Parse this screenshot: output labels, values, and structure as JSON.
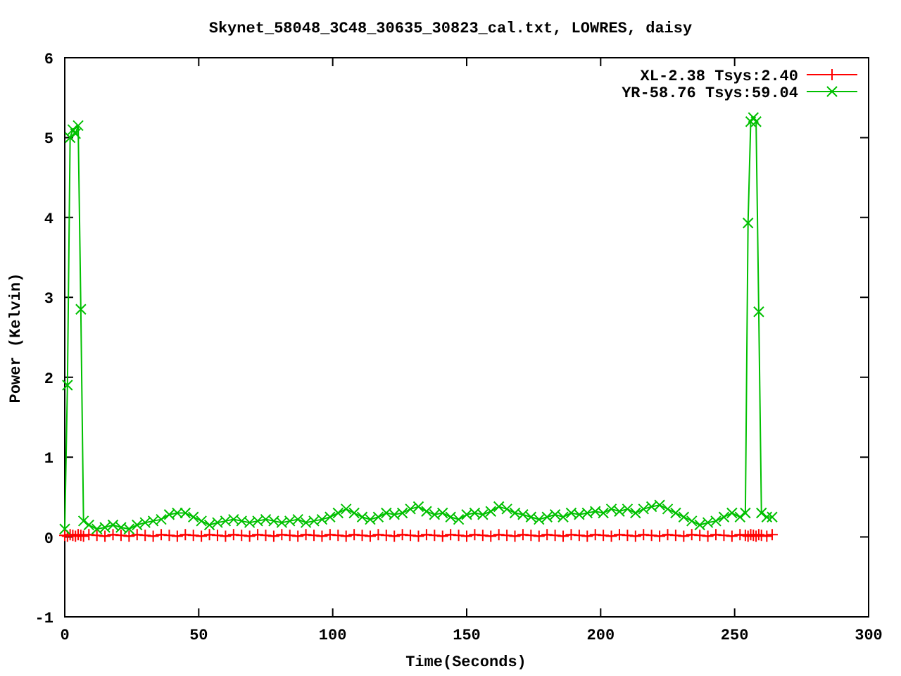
{
  "chart_data": {
    "type": "line",
    "title": "Skynet_58048_3C48_30635_30823_cal.txt, LOWRES, daisy",
    "xlabel": "Time(Seconds)",
    "ylabel": "Power (Kelvin)",
    "xlim": [
      0,
      300
    ],
    "ylim": [
      -1,
      6
    ],
    "xticks": [
      0,
      50,
      100,
      150,
      200,
      250,
      300
    ],
    "yticks": [
      -1,
      0,
      1,
      2,
      3,
      4,
      5,
      6
    ],
    "legend": true,
    "x": [
      0,
      1,
      2,
      3,
      4,
      5,
      6,
      7,
      9,
      12,
      15,
      18,
      21,
      24,
      27,
      30,
      33,
      36,
      39,
      42,
      45,
      48,
      51,
      54,
      57,
      60,
      63,
      66,
      69,
      72,
      75,
      78,
      81,
      84,
      87,
      90,
      93,
      96,
      99,
      102,
      105,
      108,
      111,
      114,
      117,
      120,
      123,
      126,
      129,
      132,
      135,
      138,
      141,
      144,
      147,
      150,
      153,
      156,
      159,
      162,
      165,
      168,
      171,
      174,
      177,
      180,
      183,
      186,
      189,
      192,
      195,
      198,
      201,
      204,
      207,
      210,
      213,
      216,
      219,
      222,
      225,
      228,
      231,
      234,
      237,
      240,
      243,
      246,
      249,
      252,
      254,
      255,
      256,
      257,
      258,
      259,
      260,
      262,
      264
    ],
    "series": [
      {
        "name": "XL-2.38 Tsys:2.40",
        "color": "#ff0000",
        "marker": "plus",
        "values": [
          0.02,
          0.01,
          0.03,
          0.02,
          0.01,
          0.03,
          0.02,
          0.01,
          0.03,
          0.02,
          0.01,
          0.03,
          0.02,
          0.01,
          0.03,
          0.02,
          0.01,
          0.03,
          0.02,
          0.01,
          0.03,
          0.02,
          0.01,
          0.03,
          0.02,
          0.01,
          0.03,
          0.02,
          0.01,
          0.03,
          0.02,
          0.01,
          0.03,
          0.02,
          0.01,
          0.03,
          0.02,
          0.01,
          0.03,
          0.02,
          0.01,
          0.03,
          0.02,
          0.01,
          0.03,
          0.02,
          0.01,
          0.03,
          0.02,
          0.01,
          0.03,
          0.02,
          0.01,
          0.03,
          0.02,
          0.01,
          0.03,
          0.02,
          0.01,
          0.03,
          0.02,
          0.01,
          0.03,
          0.02,
          0.01,
          0.03,
          0.02,
          0.01,
          0.03,
          0.02,
          0.01,
          0.03,
          0.02,
          0.01,
          0.03,
          0.02,
          0.01,
          0.03,
          0.02,
          0.01,
          0.03,
          0.02,
          0.01,
          0.03,
          0.02,
          0.01,
          0.03,
          0.02,
          0.01,
          0.03,
          0.02,
          0.01,
          0.03,
          0.02,
          0.01,
          0.03,
          0.02,
          0.01,
          0.03
        ]
      },
      {
        "name": "YR-58.76 Tsys:59.04",
        "color": "#00c000",
        "marker": "cross",
        "values": [
          0.1,
          1.9,
          5.0,
          5.1,
          5.05,
          5.15,
          2.85,
          0.2,
          0.15,
          0.1,
          0.12,
          0.15,
          0.12,
          0.1,
          0.15,
          0.18,
          0.2,
          0.22,
          0.28,
          0.3,
          0.3,
          0.25,
          0.2,
          0.15,
          0.18,
          0.2,
          0.22,
          0.2,
          0.18,
          0.2,
          0.22,
          0.2,
          0.18,
          0.2,
          0.22,
          0.18,
          0.2,
          0.22,
          0.25,
          0.3,
          0.35,
          0.3,
          0.25,
          0.22,
          0.25,
          0.3,
          0.28,
          0.3,
          0.35,
          0.38,
          0.32,
          0.28,
          0.3,
          0.25,
          0.22,
          0.28,
          0.3,
          0.28,
          0.32,
          0.38,
          0.35,
          0.3,
          0.28,
          0.25,
          0.22,
          0.25,
          0.28,
          0.25,
          0.3,
          0.28,
          0.3,
          0.32,
          0.3,
          0.35,
          0.32,
          0.35,
          0.3,
          0.35,
          0.38,
          0.4,
          0.35,
          0.3,
          0.25,
          0.2,
          0.15,
          0.18,
          0.2,
          0.25,
          0.3,
          0.25,
          0.3,
          3.93,
          5.2,
          5.25,
          5.2,
          2.82,
          0.3,
          0.25,
          0.25
        ]
      }
    ]
  }
}
